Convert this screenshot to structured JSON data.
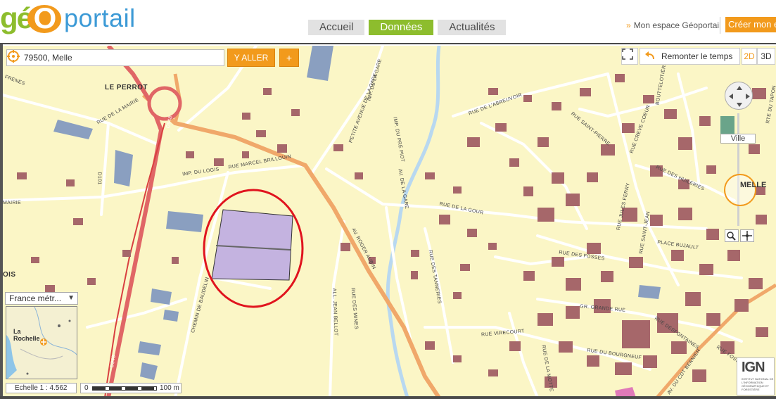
{
  "header": {
    "logo_geo": "gé",
    "logo_o": "O",
    "logo_portail": "portail",
    "tabs": [
      {
        "label": "Accueil",
        "active": false
      },
      {
        "label": "Données",
        "active": true
      },
      {
        "label": "Actualités",
        "active": false
      }
    ],
    "mon_espace": "Mon espace Géoportail",
    "creer": "Créer mon e"
  },
  "search": {
    "value": "79500, Melle",
    "go_label": "Y ALLER",
    "plus_label": "+"
  },
  "tools": {
    "remonter": "Remonter le temps",
    "view_2d": "2D",
    "view_3d": "3D",
    "zoom_level_label": "Ville",
    "place_label": "MELLE"
  },
  "minimap": {
    "region": "France métr...",
    "city": "La Rochelle"
  },
  "scale": {
    "text": "Echelle 1 :  4.562",
    "zero": "0",
    "length": "100 m"
  },
  "ign": {
    "logo": "IGN",
    "subtitle": "INSTITUT NATIONAL DE L'INFORMATION GÉOGRAPHIQUE ET FORESTIÈRE"
  },
  "map_labels": {
    "le_perrot": "LE PERROT",
    "frenes": "FRENES",
    "mairie": "MAIRIE",
    "ois": "OIS",
    "rue_mairie": "RUE DE LA MAIRIE",
    "d101": "D101",
    "d948": "D948",
    "d948b": "D948",
    "imp_logis": "IMP. DU LOGIS",
    "rue_marcel": "RUE MARCEL BRILLOUIN",
    "chemin_baudelin": "CHEMIN DE BAUDELIN",
    "imp_gare": "IMP. DE LA GARE",
    "petite_gare": "PETITE AVENUE DE LA GARE",
    "imp_pre_piot": "IMP. DU PRÉ PIOT",
    "av_gare": "AV. DE LA GARE",
    "rue_gour": "RUE DE LA GOUR",
    "av_roger": "AV. ROGER AUBIN",
    "rue_tanneries": "RUE DES TANNERIES",
    "rue_mines": "RUE DES MINES",
    "all_jean": "ALL. JEAN BELLOT",
    "rue_abreuvoir": "RUE DE L'ABREUVOIR",
    "rue_saint_pierre": "RUE SAINT-PIERRE",
    "rue_creve": "RUE CREVE COEUR",
    "rue_huileries": "RUE DES HUILERIES",
    "rue_jules": "RUE JULES FERRY",
    "rue_saint_jean": "RUE SAINT-JEAN",
    "rue_fosses": "RUE DES FOSSES",
    "place_bujault": "PLACE BUJAULT",
    "gr_grande": "GR. GRANDE RUE",
    "rue_desfontaines": "RUE DESFONTAINES",
    "rue_virecourt": "RUE VIRECOURT",
    "rue_motte": "RUE DE LA MOTTE",
    "rue_bourgneuf": "RUE DU BOURGNEUF",
    "av_cdt": "AV. DU CDT BERNIER",
    "rue_fossema": "RUE FOSSEMA",
    "buttelotiere": "BOUTTELOTIÈRE",
    "rte_tapon": "RTE DU TAPON"
  },
  "colors": {
    "map_bg": "#fbf6c6",
    "building": "#a6676a",
    "road_main": "#e06666",
    "road_secondary": "#f0a86a",
    "river": "#b8d8f0",
    "parcel": "#c4b3e0",
    "highlight": "#e0141e",
    "accent": "#f29a1c",
    "brand_green": "#8dbd2d"
  }
}
